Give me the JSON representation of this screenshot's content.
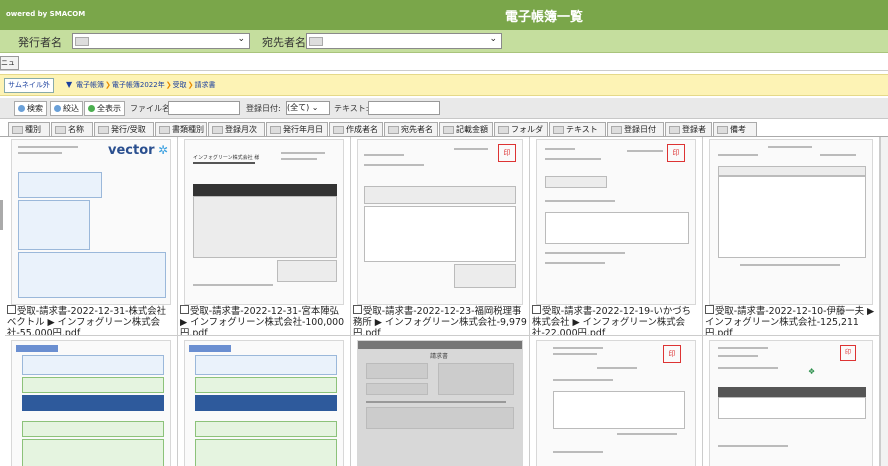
{
  "header": {
    "powered": "owered by SMACOM",
    "title": "電子帳簿一覧"
  },
  "filters": {
    "issuer_label": "発行者名",
    "recipient_label": "宛先者名"
  },
  "menu_label": "ニュー",
  "crumb": {
    "thumb_button": "サムネイル外",
    "path": [
      "電子帳簿",
      "電子帳簿2022年",
      "受取",
      "請求書"
    ]
  },
  "toolbar": {
    "search": "検索",
    "narrow": "絞込",
    "show_all": "全表示",
    "filename_label": "ファイル名:",
    "regdate_label": "登録日付:",
    "regdate_value": "(全て)",
    "text_label": "テキスト:"
  },
  "tabs": [
    "種別",
    "名称",
    "発行/受取",
    "書類種別",
    "登録月次",
    "発行年月日",
    "作成者名",
    "宛先者名",
    "記載金額",
    "フォルダ",
    "テキスト",
    "登録日付",
    "登録者",
    "備考"
  ],
  "documents": [
    {
      "caption": "受取-請求書-2022-12-31-株式会社ベクトル ▶ インフォグリーン株式会社-55,000円.pdf",
      "logo": "vector"
    },
    {
      "caption": "受取-請求書-2022-12-31-宮本陣弘 ▶ インフォグリーン株式会社-100,000円.pdf",
      "logo": "インフォグリーン株式会社 様"
    },
    {
      "caption": "受取-請求書-2022-12-23-福岡税理事務所 ▶ インフォグリーン株式会社-9,979円.pdf",
      "logo": ""
    },
    {
      "caption": "受取-請求書-2022-12-19-いかづち株式会社 ▶ インフォグリーン株式会社-22,000円.pdf",
      "logo": ""
    },
    {
      "caption": "受取-請求書-2022-12-10-伊藤一夫 ▶ インフォグリーン株式会社-125,211円.pdf",
      "logo": ""
    },
    {
      "caption": "",
      "logo": ""
    },
    {
      "caption": "",
      "logo": ""
    },
    {
      "caption": "",
      "logo": "請求書"
    },
    {
      "caption": "",
      "logo": ""
    },
    {
      "caption": "",
      "logo": ""
    }
  ],
  "colors": {
    "header": "#7aa64a",
    "filterbar": "#c5de9e",
    "crumbbar": "#fdf3b5",
    "link": "#1a3f9e"
  }
}
